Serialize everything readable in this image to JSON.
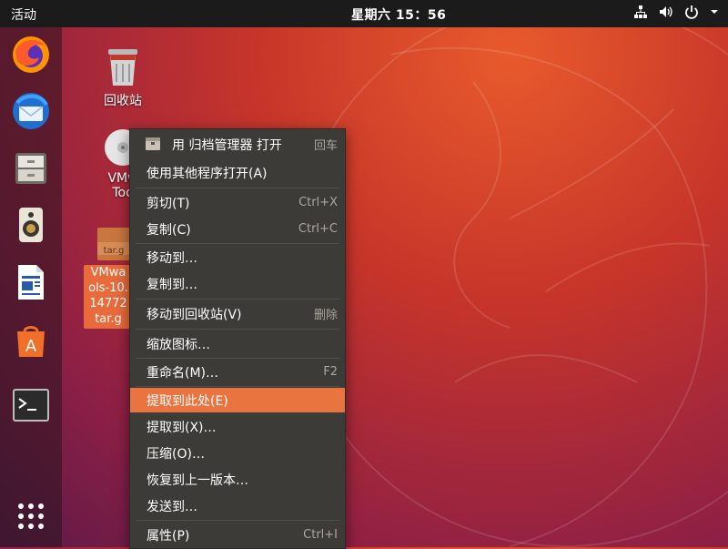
{
  "topbar": {
    "activities": "活动",
    "clock": "星期六 15：56",
    "tray_icons": [
      "network-icon",
      "volume-icon",
      "power-icon",
      "chevron-down-icon"
    ]
  },
  "dock": {
    "items": [
      "firefox-icon",
      "thunderbird-icon",
      "files-icon",
      "rhythmbox-icon",
      "libreoffice-writer-icon",
      "software-center-icon",
      "terminal-icon",
      "app-grid-icon"
    ]
  },
  "desktop": {
    "trash_label": "回收站",
    "dvd_label_line1": "VMw",
    "dvd_label_line2": "Too",
    "tar_badge": "tar.g",
    "tar_label_lines": [
      "VMwa",
      "ols-10.",
      "14772",
      "tar.g"
    ]
  },
  "context_menu": {
    "items": [
      {
        "label": "用 归档管理器 打开",
        "shortcut": "回车",
        "icon": "archive-manager-icon"
      },
      {
        "label": "使用其他程序打开(A)",
        "shortcut": ""
      },
      {
        "label": "剪切(T)",
        "shortcut": "Ctrl+X"
      },
      {
        "label": "复制(C)",
        "shortcut": "Ctrl+C"
      },
      {
        "label": "移动到…",
        "shortcut": ""
      },
      {
        "label": "复制到…",
        "shortcut": ""
      },
      {
        "label": "移动到回收站(V)",
        "shortcut": "删除"
      },
      {
        "label": "缩放图标…",
        "shortcut": ""
      },
      {
        "label": "重命名(M)…",
        "shortcut": "F2"
      },
      {
        "label": "提取到此处(E)",
        "shortcut": ""
      },
      {
        "label": "提取到(X)…",
        "shortcut": ""
      },
      {
        "label": "压缩(O)…",
        "shortcut": ""
      },
      {
        "label": "恢复到上一版本…",
        "shortcut": ""
      },
      {
        "label": "发送到…",
        "shortcut": ""
      },
      {
        "label": "属性(P)",
        "shortcut": "Ctrl+I"
      }
    ],
    "active_item": "提取到此处(E)",
    "accent_color": "#e9743f"
  }
}
